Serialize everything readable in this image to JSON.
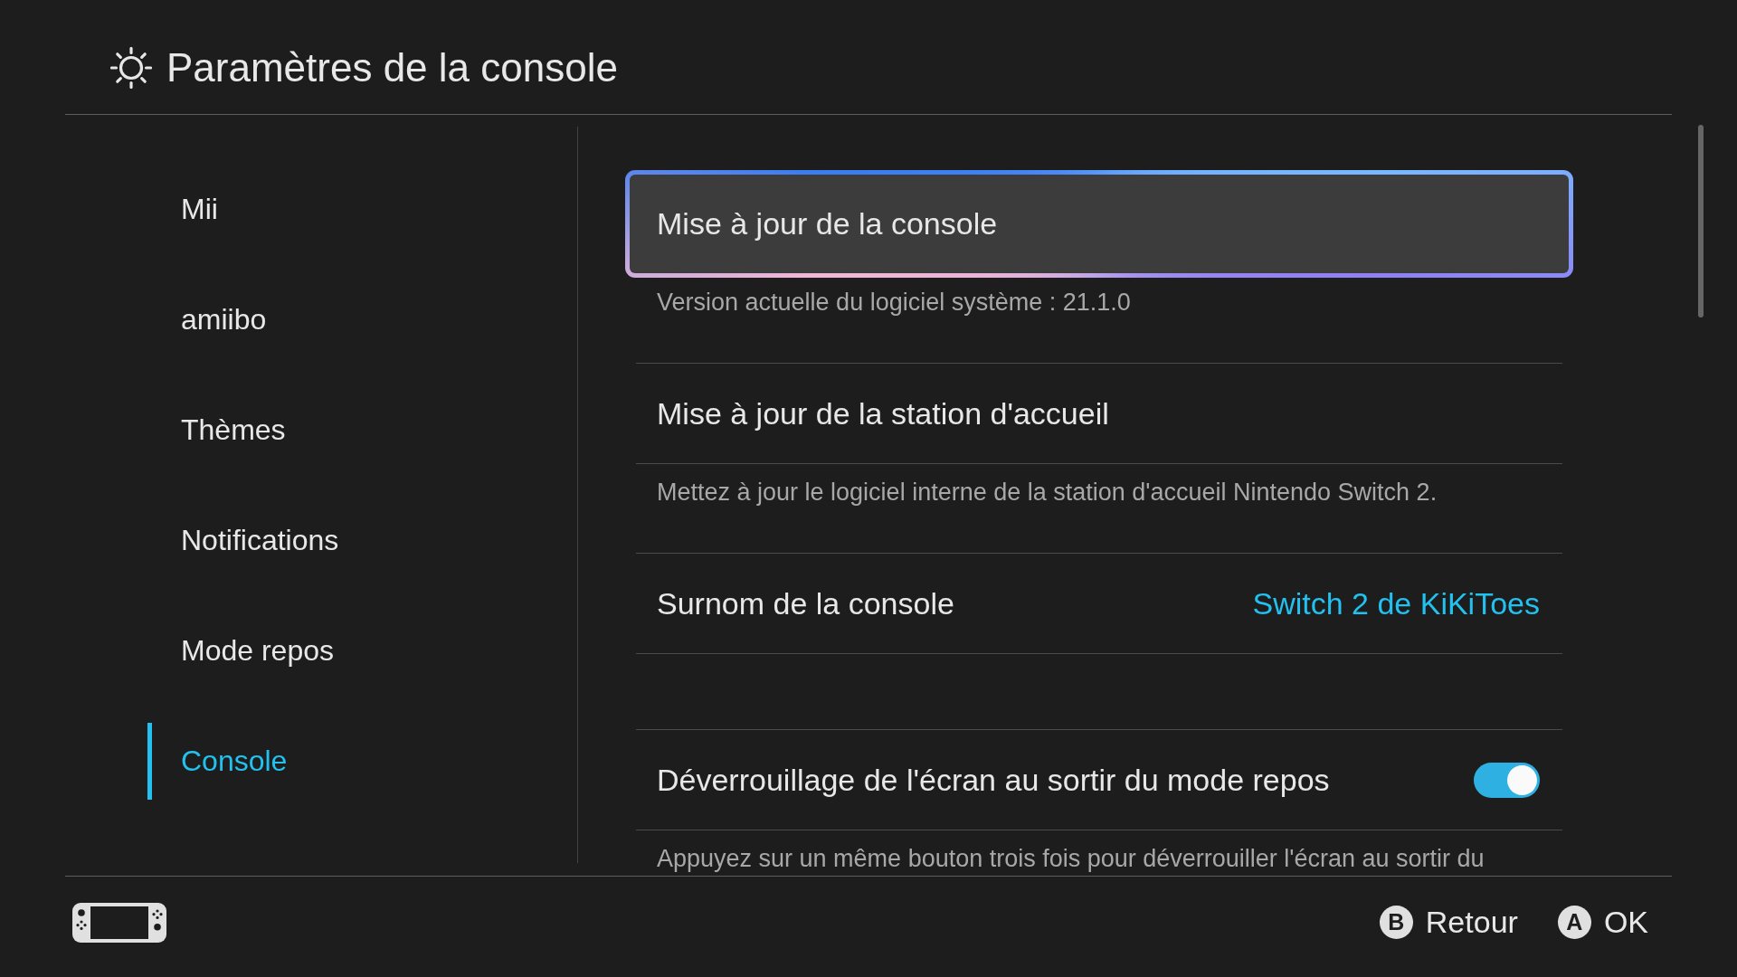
{
  "header": {
    "title": "Paramètres de la console"
  },
  "sidebar": {
    "items": [
      {
        "label": "Mii",
        "selected": false
      },
      {
        "label": "amiibo",
        "selected": false
      },
      {
        "label": "Thèmes",
        "selected": false
      },
      {
        "label": "Notifications",
        "selected": false
      },
      {
        "label": "Mode repos",
        "selected": false
      },
      {
        "label": "Console",
        "selected": true
      }
    ]
  },
  "settings": {
    "sections": [
      {
        "rows": [
          {
            "kind": "button",
            "label": "Mise à jour de la console",
            "selected": true,
            "description": "Version actuelle du logiciel système : 21.1.0"
          },
          {
            "kind": "button",
            "label": "Mise à jour de la station d'accueil",
            "selected": false,
            "description": "Mettez à jour le logiciel interne de la station d'accueil Nintendo Switch 2."
          },
          {
            "kind": "value",
            "label": "Surnom de la console",
            "selected": false,
            "value": "Switch 2 de KiKiToes"
          }
        ]
      },
      {
        "rows": [
          {
            "kind": "toggle",
            "label": "Déverrouillage de l'écran au sortir du mode repos",
            "selected": false,
            "on": true,
            "description": "Appuyez sur un même bouton trois fois pour déverrouiller l'écran au sortir du"
          }
        ]
      }
    ]
  },
  "footer": {
    "buttons": [
      {
        "key": "B",
        "label": "Retour"
      },
      {
        "key": "A",
        "label": "OK"
      }
    ]
  }
}
